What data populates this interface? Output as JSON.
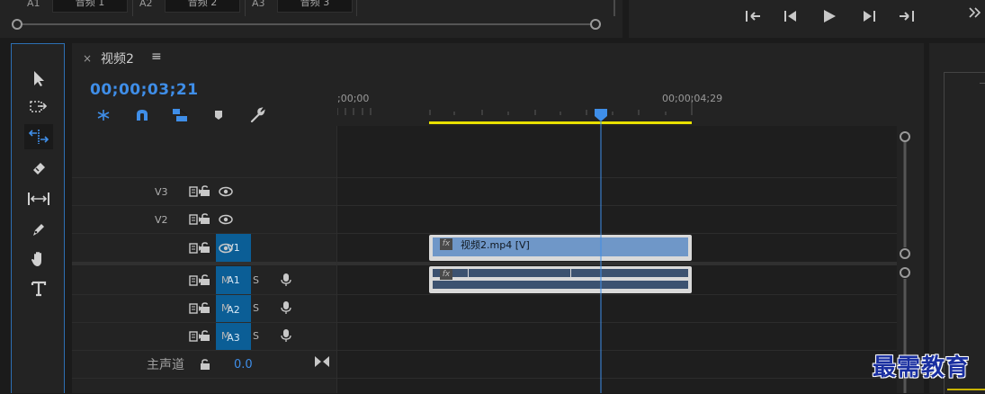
{
  "source_monitor": {
    "tracks": [
      {
        "id": "A1",
        "name": "音频 1"
      },
      {
        "id": "A2",
        "name": "音频 2"
      },
      {
        "id": "A3",
        "name": "音频 3"
      }
    ]
  },
  "program_controls": [
    "mark-in-icon",
    "step-back-icon",
    "play-icon",
    "step-forward-icon",
    "mark-out-icon",
    "more-icon"
  ],
  "panel": {
    "tab_close": "×",
    "tab_title": "视频2",
    "tab_menu": "≡",
    "timecode": "00;00;03;21"
  },
  "ruler": {
    "start_label": ";00;00",
    "end_label": "00;00;04;29"
  },
  "video_tracks": [
    {
      "id": "V3",
      "targeted": false
    },
    {
      "id": "V2",
      "targeted": false
    },
    {
      "id": "V1",
      "targeted": true
    }
  ],
  "audio_tracks": [
    {
      "id": "A1",
      "m": "M",
      "s": "S"
    },
    {
      "id": "A2",
      "m": "M",
      "s": "S"
    },
    {
      "id": "A3",
      "m": "M",
      "s": "S"
    }
  ],
  "master": {
    "label": "主声道",
    "value": "0.0"
  },
  "clips": {
    "video": {
      "fx": "fx",
      "name": "视频2.mp4 [V]"
    },
    "audio": {
      "fx": "fx"
    }
  },
  "watermark": "最需教育",
  "colors": {
    "accent_blue": "#3f8ee8",
    "track_target": "#0b5e96",
    "video_clip": "#6f97c8",
    "audio_clip": "#3c5270",
    "work_area": "#e8e000"
  }
}
